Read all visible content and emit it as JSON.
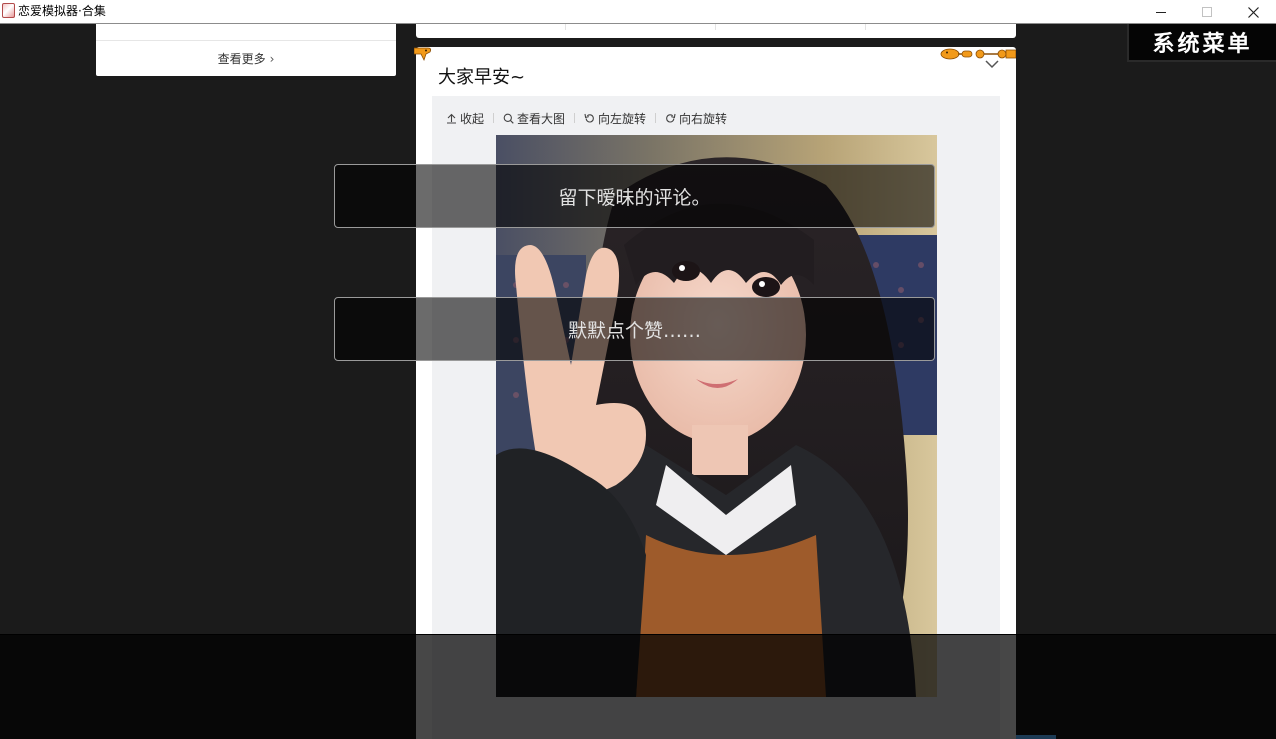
{
  "window": {
    "title": "恋爱模拟器·合集",
    "minimize_label": "—",
    "maximize_label": "□",
    "close_label": "✕"
  },
  "left_panel": {
    "more_label": "查看更多",
    "more_chevron": "›"
  },
  "post": {
    "text": "大家早安~",
    "toolbar": {
      "collapse_label": "收起",
      "view_large_label": "查看大图",
      "rotate_left_label": "向左旋转",
      "rotate_right_label": "向右旋转"
    }
  },
  "system_menu": {
    "label": "系统菜单"
  },
  "choices": [
    {
      "label": "留下暧昧的评论。"
    },
    {
      "label": "默默点个赞……"
    }
  ],
  "colors": {
    "background": "#1b1b1b",
    "card": "#ffffff",
    "media_bg": "#f0f1f3",
    "deco_orange": "#f29a1a"
  },
  "icons": {
    "collapse": "arrow-up-icon",
    "view_large": "magnifier-icon",
    "rotate_left": "rotate-left-icon",
    "rotate_right": "rotate-right-icon",
    "expand": "chevron-down-icon"
  }
}
